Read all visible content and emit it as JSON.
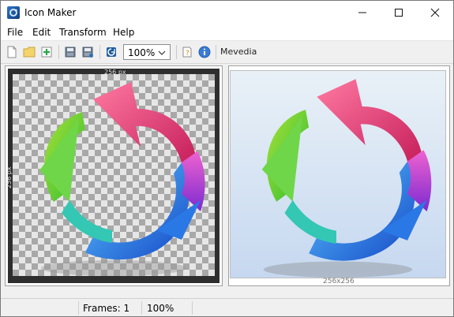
{
  "window": {
    "title": "Icon Maker"
  },
  "menu": [
    "File",
    "Edit",
    "Transform",
    "Help"
  ],
  "toolbar": {
    "zoom": "100%",
    "brand": "Mevedia"
  },
  "editor": {
    "ruler_top": "256 px",
    "ruler_left": "256 px"
  },
  "preview": {
    "caption": "256x256"
  },
  "status": {
    "frames": "Frames: 1",
    "zoom": "100%"
  }
}
